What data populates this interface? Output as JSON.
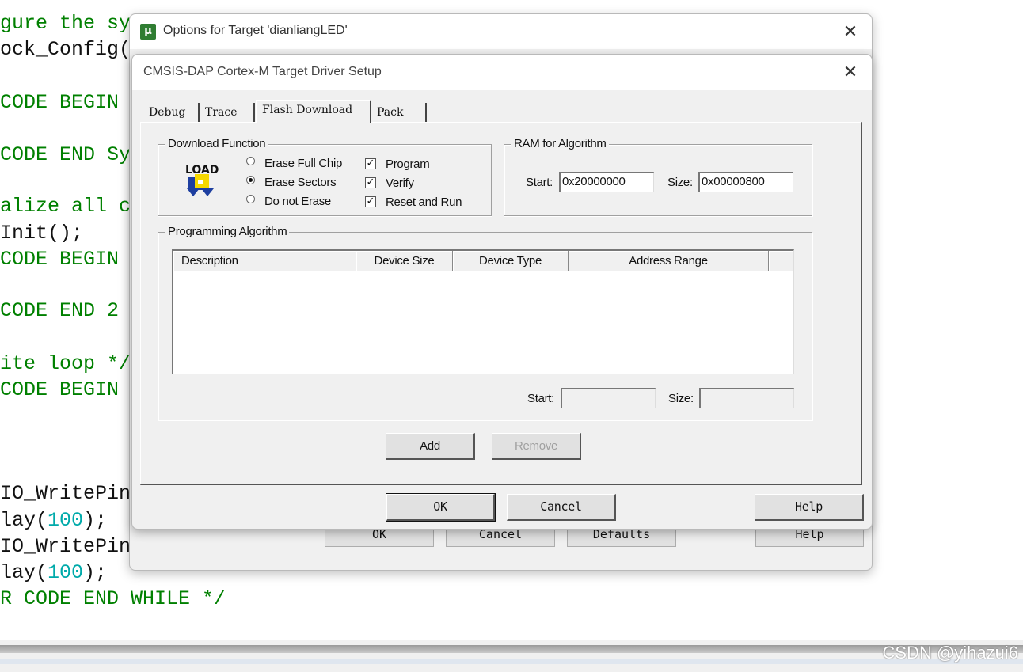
{
  "code_lines": [
    {
      "segments": [
        {
          "t": "gure the sy",
          "c": "c"
        }
      ]
    },
    {
      "segments": [
        {
          "t": "ock_Config(",
          "c": "p"
        }
      ]
    },
    {
      "segments": [
        {
          "t": "CODE BEGIN ",
          "c": "c"
        }
      ]
    },
    {
      "segments": [
        {
          "t": "CODE END Sy",
          "c": "c"
        }
      ]
    },
    {
      "segments": [
        {
          "t": "alize all c",
          "c": "c"
        }
      ]
    },
    {
      "segments": [
        {
          "t": "Init();",
          "c": "p"
        }
      ]
    },
    {
      "segments": [
        {
          "t": "CODE BEGIN ",
          "c": "c"
        }
      ]
    },
    {
      "segments": [
        {
          "t": "CODE END 2 ",
          "c": "c"
        }
      ]
    },
    {
      "segments": [
        {
          "t": "ite loop */",
          "c": "c"
        }
      ]
    },
    {
      "segments": [
        {
          "t": "CODE BEGIN ",
          "c": "c"
        }
      ]
    },
    {
      "segments": [
        {
          "t": "IO_WritePin",
          "c": "p"
        }
      ]
    },
    {
      "segments": [
        {
          "t": "lay(",
          "c": "p"
        },
        {
          "t": "100",
          "c": "n"
        },
        {
          "t": ");",
          "c": "p"
        }
      ]
    },
    {
      "segments": [
        {
          "t": "IO_WritePin",
          "c": "p"
        }
      ]
    },
    {
      "segments": [
        {
          "t": "lay(",
          "c": "p"
        },
        {
          "t": "100",
          "c": "n"
        },
        {
          "t": ");",
          "c": "p"
        }
      ]
    },
    {
      "segments": [
        {
          "t": "R CODE END WHILE */",
          "c": "c"
        }
      ]
    }
  ],
  "outer_dialog": {
    "title": "Options for Target 'dianliangLED'",
    "app_icon": "keil-uvision-icon",
    "buttons": {
      "ok": "OK",
      "cancel": "Cancel",
      "defaults": "Defaults",
      "help": "Help"
    }
  },
  "inner_dialog": {
    "title": "CMSIS-DAP Cortex-M Target Driver Setup",
    "tabs": [
      "Debug",
      "Trace",
      "Flash Download",
      "Pack"
    ],
    "active_tab": "Flash Download",
    "download_function": {
      "legend": "Download Function",
      "icon_text": "LOAD",
      "radios": [
        {
          "label": "Erase Full Chip",
          "checked": false
        },
        {
          "label": "Erase Sectors",
          "checked": true
        },
        {
          "label": "Do not Erase",
          "checked": false
        }
      ],
      "checkboxes": [
        {
          "label": "Program",
          "checked": true
        },
        {
          "label": "Verify",
          "checked": true
        },
        {
          "label": "Reset and Run",
          "checked": true
        }
      ]
    },
    "ram_for_algorithm": {
      "legend": "RAM for Algorithm",
      "start_label": "Start:",
      "start_value": "0x20000000",
      "size_label": "Size:",
      "size_value": "0x00000800"
    },
    "programming_algorithm": {
      "legend": "Programming Algorithm",
      "columns": [
        "Description",
        "Device Size",
        "Device Type",
        "Address Range"
      ],
      "rows": [],
      "start_label": "Start:",
      "start_value": "",
      "size_label": "Size:",
      "size_value": ""
    },
    "buttons": {
      "add": "Add",
      "remove": "Remove",
      "ok": "OK",
      "cancel": "Cancel",
      "help": "Help"
    }
  },
  "watermark": "CSDN @yihazui6"
}
